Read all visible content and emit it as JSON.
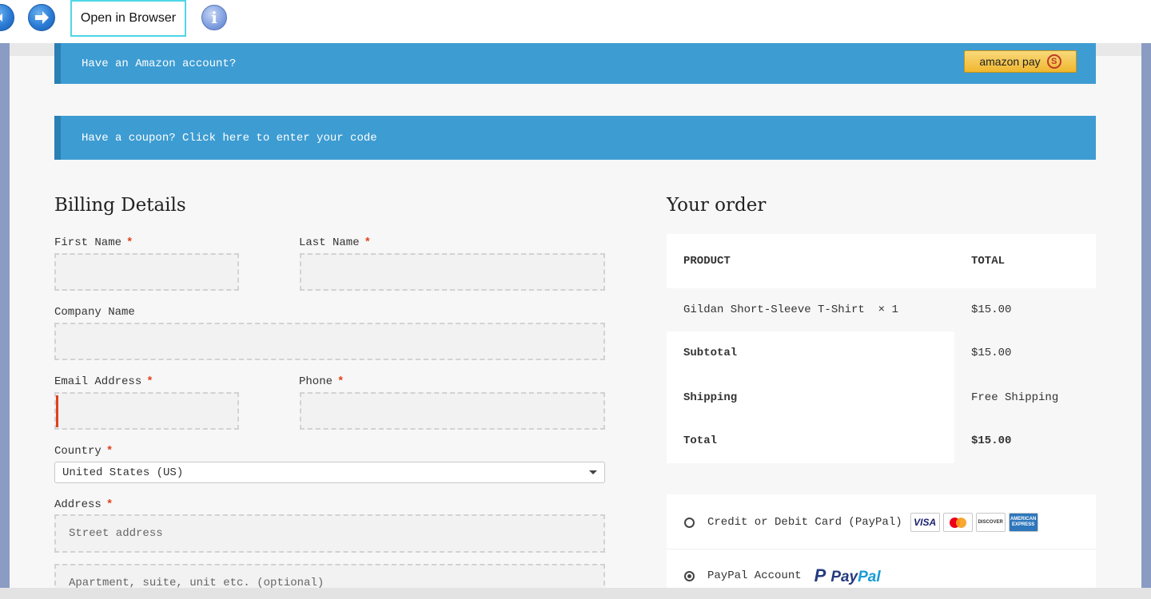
{
  "toolbar": {
    "open_in_browser_label": "Open in Browser",
    "info_glyph": "i",
    "icons": [
      "back-arrow-icon",
      "forward-arrow-icon",
      "info-icon"
    ]
  },
  "notices": {
    "amazon": "Have an Amazon account?",
    "amazon_pay_label": "amazon pay",
    "amazon_pay_glyph": "S",
    "coupon": "Have a coupon? Click here to enter your code"
  },
  "billing": {
    "title": "Billing Details",
    "required_mark": "*",
    "first_name_label": "First Name",
    "last_name_label": "Last Name",
    "company_label": "Company Name",
    "email_label": "Email Address",
    "phone_label": "Phone",
    "country_label": "Country",
    "country_value": "United States (US)",
    "address_label": "Address",
    "street_placeholder": "Street address",
    "apartment_placeholder": "Apartment, suite, unit etc. (optional)"
  },
  "order": {
    "title": "Your order",
    "col_product": "PRODUCT",
    "col_total": "TOTAL",
    "item_name": "Gildan Short-Sleeve T-Shirt",
    "item_qty": "× 1",
    "item_total": "$15.00",
    "subtotal_label": "Subtotal",
    "subtotal_value": "$15.00",
    "shipping_label": "Shipping",
    "shipping_value": "Free Shipping",
    "total_label": "Total",
    "total_value": "$15.00"
  },
  "payment": {
    "card_label": "Credit or Debit Card (PayPal)",
    "cards": {
      "visa": "VISA",
      "discover": "DISCOVER",
      "amex": "AMERICAN EXPRESS"
    },
    "paypal_label": "PayPal Account",
    "paypal_logo_a": "Pay",
    "paypal_logo_b": "Pal",
    "paypal_logo_p": "P",
    "selected": "paypal"
  },
  "colors": {
    "notice_blue": "#3d9cd2",
    "required_red": "#e2401c",
    "focus_cyan": "#4fd6e6"
  }
}
